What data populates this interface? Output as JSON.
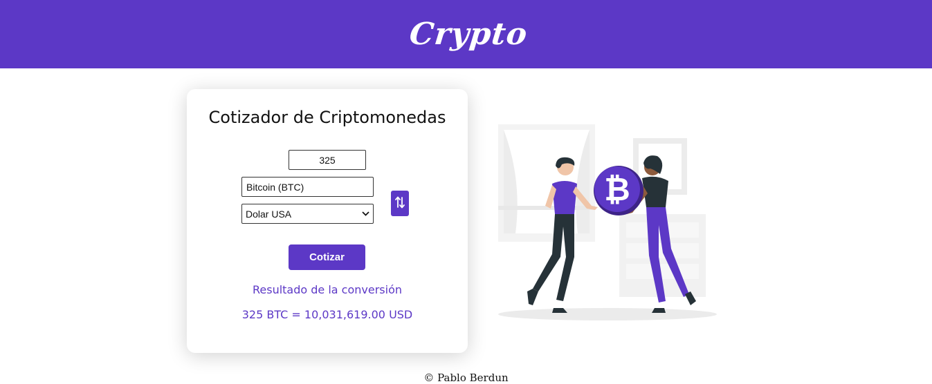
{
  "header": {
    "brand": "Crypto"
  },
  "converter": {
    "title": "Cotizador de Criptomonedas",
    "amount_value": "325",
    "from_currency": "Bitcoin (BTC)",
    "to_currency": "Dolar USA",
    "submit_label": "Cotizar"
  },
  "result": {
    "title": "Resultado de la conversión",
    "value": "325 BTC = 10,031,619.00 USD"
  },
  "footer": {
    "text": "© Pablo Berdun"
  },
  "colors": {
    "accent": "#5c38c6",
    "dark": "#263238"
  },
  "icons": {
    "swap": "swap-vertical-icon",
    "coin": "bitcoin-icon"
  }
}
